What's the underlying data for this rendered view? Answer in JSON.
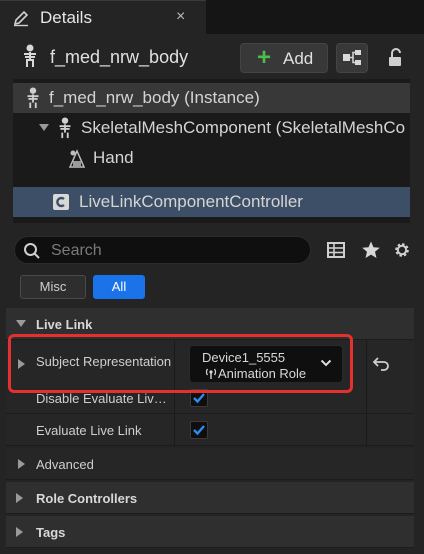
{
  "tab": {
    "title": "Details",
    "close": "×"
  },
  "header": {
    "actor_name": "f_med_nrw_body",
    "add_label": "Add"
  },
  "tree": {
    "rows": [
      {
        "label": "f_med_nrw_body (Instance)"
      },
      {
        "label": "SkeletalMeshComponent (SkeletalMeshCo"
      },
      {
        "label": "Hand"
      },
      {
        "label": "LiveLinkComponentController"
      }
    ]
  },
  "search": {
    "placeholder": "Search"
  },
  "filters": {
    "misc": "Misc",
    "all": "All"
  },
  "sections": {
    "live_link": "Live Link",
    "advanced": "Advanced",
    "role_controllers": "Role Controllers",
    "tags": "Tags"
  },
  "properties": {
    "subject_representation": {
      "label": "Subject Representation",
      "subject": "Device1_5555",
      "role": "Animation Role"
    },
    "disable_evaluate": {
      "label": "Disable Evaluate Live Link When Spawnable",
      "checked": true
    },
    "evaluate_live_link": {
      "label": "Evaluate Live Link",
      "checked": true
    }
  },
  "colors": {
    "accent": "#1a73e8",
    "highlight": "#e53030",
    "add_plus": "#4cbc4c",
    "selection": "#3c4f66"
  }
}
